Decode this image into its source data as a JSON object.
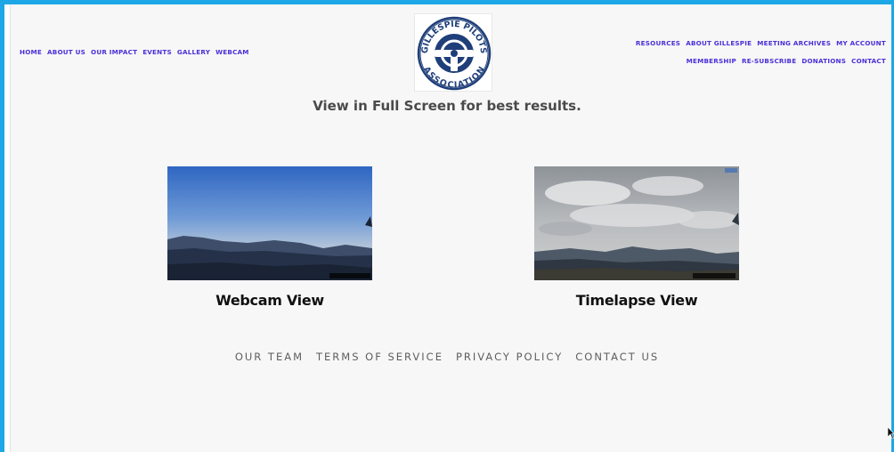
{
  "nav_left": [
    {
      "label": "HOME"
    },
    {
      "label": "ABOUT US"
    },
    {
      "label": "OUR IMPACT"
    },
    {
      "label": "EVENTS"
    },
    {
      "label": "GALLERY"
    },
    {
      "label": "WEBCAM"
    }
  ],
  "nav_right_top": [
    {
      "label": "RESOURCES"
    },
    {
      "label": "ABOUT GILLESPIE"
    },
    {
      "label": "MEETING ARCHIVES"
    },
    {
      "label": "MY ACCOUNT"
    }
  ],
  "nav_right_bottom": [
    {
      "label": "MEMBERSHIP"
    },
    {
      "label": "RE-SUBSCRIBE"
    },
    {
      "label": "DONATIONS"
    },
    {
      "label": "CONTACT"
    }
  ],
  "logo": {
    "text": "GILLESPIE PILOTS ASSOCIATION"
  },
  "tagline": "View in Full Screen for best results.",
  "cards": [
    {
      "title": "Webcam View"
    },
    {
      "title": "Timelapse View"
    }
  ],
  "footer": [
    {
      "label": "OUR TEAM"
    },
    {
      "label": "TERMS OF SERVICE"
    },
    {
      "label": "PRIVACY POLICY"
    },
    {
      "label": "CONTACT US"
    }
  ],
  "colors": {
    "nav_link": "#4b2fd6",
    "frame_border": "#1ea7e6",
    "logo_navy": "#1f3f7a"
  }
}
